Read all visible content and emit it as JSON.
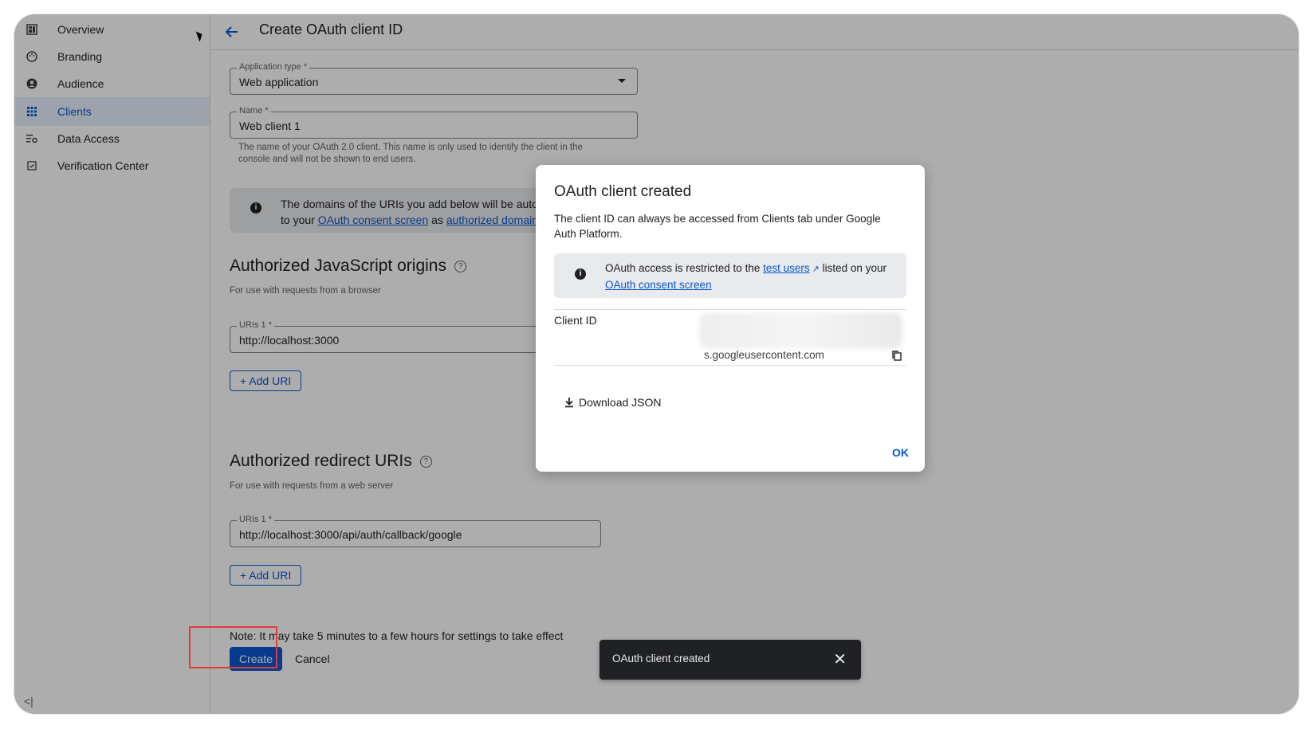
{
  "sidebar": {
    "items": [
      {
        "label": "Overview",
        "icon": "dashboard-icon"
      },
      {
        "label": "Branding",
        "icon": "palette-icon"
      },
      {
        "label": "Audience",
        "icon": "person-circle-icon"
      },
      {
        "label": "Clients",
        "icon": "grid-icon",
        "active": true
      },
      {
        "label": "Data Access",
        "icon": "data-access-icon"
      },
      {
        "label": "Verification Center",
        "icon": "verified-icon"
      }
    ],
    "collapse_label": "<|"
  },
  "header": {
    "title": "Create OAuth client ID"
  },
  "form": {
    "app_type": {
      "label": "Application type *",
      "value": "Web application"
    },
    "name": {
      "label": "Name *",
      "value": "Web client 1"
    },
    "name_help": "The name of your OAuth 2.0 client. This name is only used to identify the client in the console and will not be shown to end users.",
    "info_line1": "The domains of the URIs you add below will be automatic",
    "info_line2_prefix": "to your ",
    "info_link1": "OAuth consent screen",
    "info_mid": " as ",
    "info_link2": "authorized domains",
    "js_origins": {
      "heading": "Authorized JavaScript origins",
      "sub": "For use with requests from a browser",
      "uri_label": "URIs 1 *",
      "uri_value": "http://localhost:3000",
      "add_label": "+ Add URI"
    },
    "redirect": {
      "heading": "Authorized redirect URIs",
      "sub": "For use with requests from a web server",
      "uri_label": "URIs 1 *",
      "uri_value": "http://localhost:3000/api/auth/callback/google",
      "add_label": "+ Add URI"
    },
    "note": "Note: It may take 5 minutes to a few hours for settings to take effect",
    "create_label": "Create",
    "cancel_label": "Cancel"
  },
  "dialog": {
    "title": "OAuth client created",
    "text": "The client ID can always be accessed from Clients tab under Google Auth Platform.",
    "info_prefix": "OAuth access is restricted to the ",
    "info_link1": "test users",
    "info_mid": " listed on your ",
    "info_link2": "OAuth consent screen",
    "client_id_label": "Client ID",
    "client_id_value": "s.googleusercontent.com",
    "download_label": "Download JSON",
    "ok_label": "OK"
  },
  "snackbar": {
    "text": "OAuth client created"
  },
  "colors": {
    "accent": "#0b57d0",
    "highlight": "#e53935",
    "snackbar": "#202124"
  }
}
